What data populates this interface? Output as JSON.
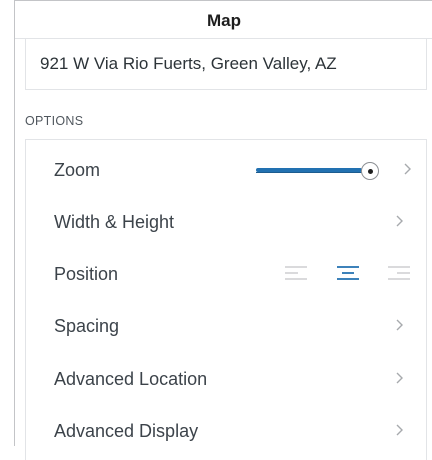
{
  "header": {
    "title": "Map"
  },
  "address": {
    "value": "921 W Via Rio Fuerts, Green Valley, AZ"
  },
  "options": {
    "section_label": "OPTIONS",
    "zoom": {
      "label": "Zoom",
      "level": 0.88
    },
    "rows": [
      {
        "label": "Width & Height",
        "icon": "chevron-right-icon"
      },
      {
        "label": "Position",
        "alignment_options": [
          "left",
          "center",
          "right"
        ],
        "selected": "center"
      },
      {
        "label": "Spacing",
        "icon": "chevron-right-icon"
      },
      {
        "label": "Advanced Location",
        "icon": "chevron-right-icon"
      },
      {
        "label": "Advanced Display",
        "icon": "chevron-right-icon"
      }
    ]
  },
  "colors": {
    "accent": "#2271b1",
    "inactive_icon": "#c3c4c7",
    "chevron": "#a7aaad",
    "border": "#e2e4e7"
  }
}
